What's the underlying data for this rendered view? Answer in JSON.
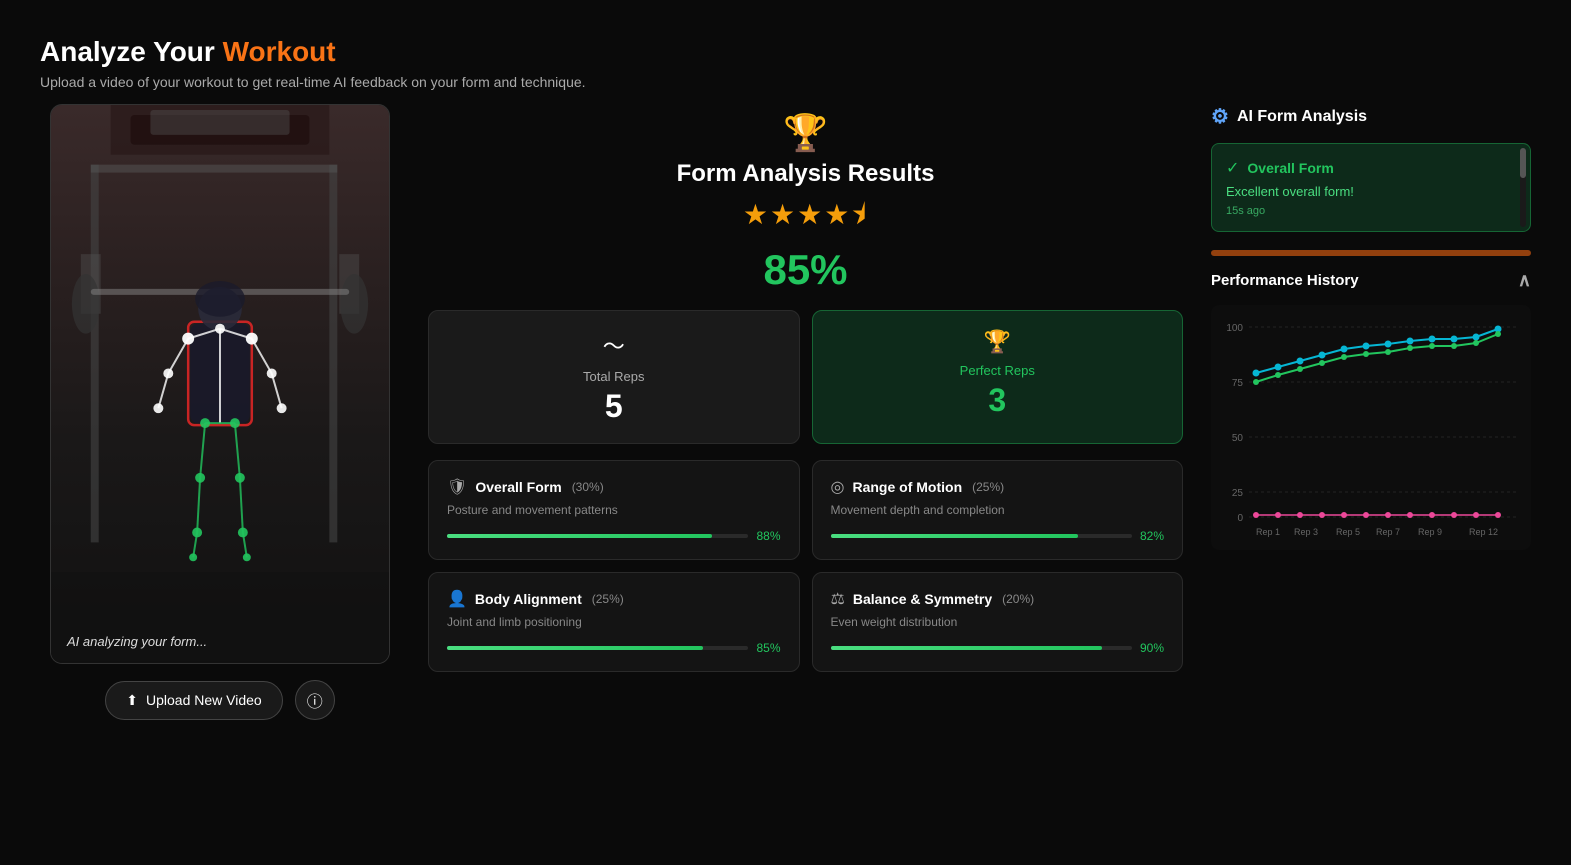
{
  "header": {
    "title_start": "Analyze Your ",
    "title_highlight": "Workout",
    "subtitle": "Upload a video of your workout to get real-time AI feedback on your form and technique."
  },
  "video": {
    "ai_label": "AI analyzing your form...",
    "upload_btn": "Upload New Video",
    "info_btn": "ⓘ"
  },
  "results": {
    "trophy": "🏆",
    "title": "Form Analysis Results",
    "stars": "★★★★½",
    "score": "85%",
    "total_reps_label": "Total Reps",
    "total_reps_value": "5",
    "perfect_reps_label": "Perfect Reps",
    "perfect_reps_value": "3"
  },
  "metrics": [
    {
      "icon": "🛡",
      "title": "Overall Form",
      "weight": "(30%)",
      "desc": "Posture and movement patterns",
      "pct": 88,
      "pct_label": "88%"
    },
    {
      "icon": "◎",
      "title": "Range of Motion",
      "weight": "(25%)",
      "desc": "Movement depth and completion",
      "pct": 82,
      "pct_label": "82%"
    },
    {
      "icon": "👤",
      "title": "Body Alignment",
      "weight": "(25%)",
      "desc": "Joint and limb positioning",
      "pct": 85,
      "pct_label": "85%"
    },
    {
      "icon": "⚖",
      "title": "Balance & Symmetry",
      "weight": "(20%)",
      "desc": "Even weight distribution",
      "pct": 90,
      "pct_label": "90%"
    }
  ],
  "ai_analysis": {
    "panel_title": "AI Form Analysis",
    "feedback_title": "Overall Form",
    "feedback_text": "Excellent overall form!",
    "feedback_time": "15s ago"
  },
  "performance_history": {
    "title": "Performance History",
    "x_labels": [
      "Rep 1",
      "Rep 3",
      "Rep 5",
      "Rep 7",
      "Rep 9",
      "Rep 12"
    ],
    "y_labels": [
      "100",
      "75",
      "50",
      "25",
      "0"
    ],
    "cyan_data": [
      78,
      82,
      85,
      88,
      90,
      92,
      93,
      94,
      95,
      95,
      96,
      98
    ],
    "green_data": [
      75,
      80,
      83,
      86,
      88,
      90,
      91,
      93,
      94,
      94,
      95,
      97
    ],
    "pink_data": [
      2,
      2,
      2,
      2,
      2,
      2,
      2,
      2,
      2,
      2,
      2,
      2
    ]
  }
}
